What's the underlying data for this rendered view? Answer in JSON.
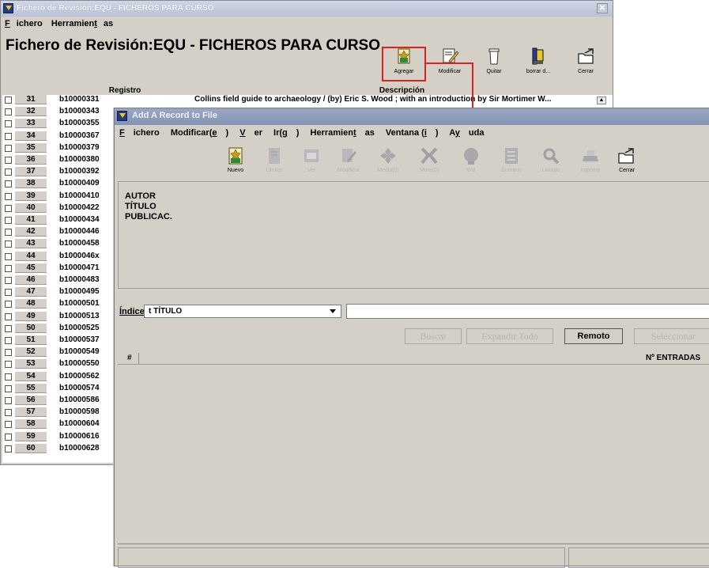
{
  "back_window": {
    "title": "Fichero de Revisión:EQU - FICHEROS PARA CURSO",
    "menu": [
      "Fichero",
      "Herramientas"
    ],
    "heading": "Fichero de Revisión:EQU - FICHEROS PARA CURSO",
    "toolbar": {
      "agregar": "Agregar",
      "modificar": "Modificar",
      "quitar": "Quitar",
      "borrar": "borrar d...",
      "cerrar": "Cerrar"
    },
    "columns": {
      "registro": "Registro",
      "descripcion": "Descripción"
    },
    "rows": [
      {
        "n": "31",
        "id": "b10000331",
        "desc": "Collins field guide to archaeology / (by) Eric S. Wood ; with an introduction by Sir Mortimer W..."
      },
      {
        "n": "32",
        "id": "b10000343",
        "desc": ""
      },
      {
        "n": "33",
        "id": "b10000355",
        "desc": ""
      },
      {
        "n": "34",
        "id": "b10000367",
        "desc": ""
      },
      {
        "n": "35",
        "id": "b10000379",
        "desc": ""
      },
      {
        "n": "36",
        "id": "b10000380",
        "desc": ""
      },
      {
        "n": "37",
        "id": "b10000392",
        "desc": ""
      },
      {
        "n": "38",
        "id": "b10000409",
        "desc": ""
      },
      {
        "n": "39",
        "id": "b10000410",
        "desc": ""
      },
      {
        "n": "40",
        "id": "b10000422",
        "desc": ""
      },
      {
        "n": "41",
        "id": "b10000434",
        "desc": ""
      },
      {
        "n": "42",
        "id": "b10000446",
        "desc": ""
      },
      {
        "n": "43",
        "id": "b10000458",
        "desc": ""
      },
      {
        "n": "44",
        "id": "b1000046x",
        "desc": ""
      },
      {
        "n": "45",
        "id": "b10000471",
        "desc": ""
      },
      {
        "n": "46",
        "id": "b10000483",
        "desc": ""
      },
      {
        "n": "47",
        "id": "b10000495",
        "desc": ""
      },
      {
        "n": "48",
        "id": "b10000501",
        "desc": ""
      },
      {
        "n": "49",
        "id": "b10000513",
        "desc": ""
      },
      {
        "n": "50",
        "id": "b10000525",
        "desc": ""
      },
      {
        "n": "51",
        "id": "b10000537",
        "desc": ""
      },
      {
        "n": "52",
        "id": "b10000549",
        "desc": ""
      },
      {
        "n": "53",
        "id": "b10000550",
        "desc": ""
      },
      {
        "n": "54",
        "id": "b10000562",
        "desc": ""
      },
      {
        "n": "55",
        "id": "b10000574",
        "desc": ""
      },
      {
        "n": "56",
        "id": "b10000586",
        "desc": ""
      },
      {
        "n": "57",
        "id": "b10000598",
        "desc": ""
      },
      {
        "n": "58",
        "id": "b10000604",
        "desc": ""
      },
      {
        "n": "59",
        "id": "b10000616",
        "desc": ""
      },
      {
        "n": "60",
        "id": "b10000628",
        "desc": ""
      }
    ]
  },
  "front_window": {
    "title": "Add A Record to File",
    "menu": [
      "Fichero",
      "Modificar(e)",
      "Ver",
      "Ir(g)",
      "Herramientas",
      "Ventana (i)",
      "Ayuda"
    ],
    "toolbar": {
      "nuevo": "Nuevo",
      "limitar": "Limitar",
      "ver": "Ver",
      "modificar": "Modificar",
      "media": "Media(0)",
      "meta": "Meta(0)",
      "wb": "WB",
      "sumario": "Sumario",
      "listado": "Listado",
      "imprimir": "Imprimir",
      "cerrar": "Cerrar"
    },
    "fields": [
      "AUTOR",
      "TÍTULO",
      "PUBLICAC."
    ],
    "indice_label": "Índice",
    "indice_value": "t TÍTULO",
    "search_value": "",
    "buttons": {
      "buscar": "Buscar",
      "expandir": "Expandir Todo",
      "remoto": "Remoto",
      "seleccionar": "Seleccionar"
    },
    "results_header": {
      "hash": "#",
      "entradas": "Nº ENTRADAS"
    }
  },
  "colors": {
    "highlight": "#d9231f",
    "window_bg": "#d4d0c8",
    "disabled_text": "#b4b4b8"
  }
}
